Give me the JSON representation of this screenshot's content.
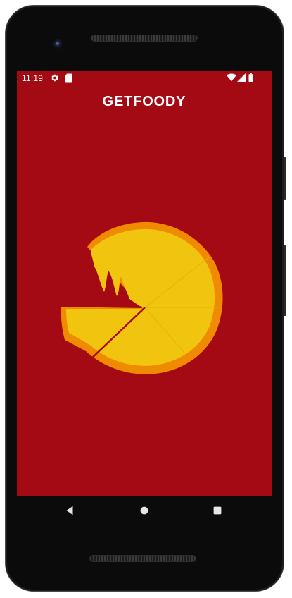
{
  "status_bar": {
    "time": "11:19",
    "icons": [
      "settings-icon",
      "sd-card-icon",
      "wifi-icon",
      "signal-icon",
      "battery-icon"
    ]
  },
  "app": {
    "title": "GETFOODY",
    "logo": "pizza-pacman-logo"
  },
  "navigation": {
    "buttons": [
      "back-icon",
      "home-icon",
      "recents-icon"
    ]
  },
  "colors": {
    "background": "#a40a14",
    "pizza_crust": "#f08a00",
    "pizza_cheese": "#f1c40f",
    "text": "#ffffff"
  }
}
